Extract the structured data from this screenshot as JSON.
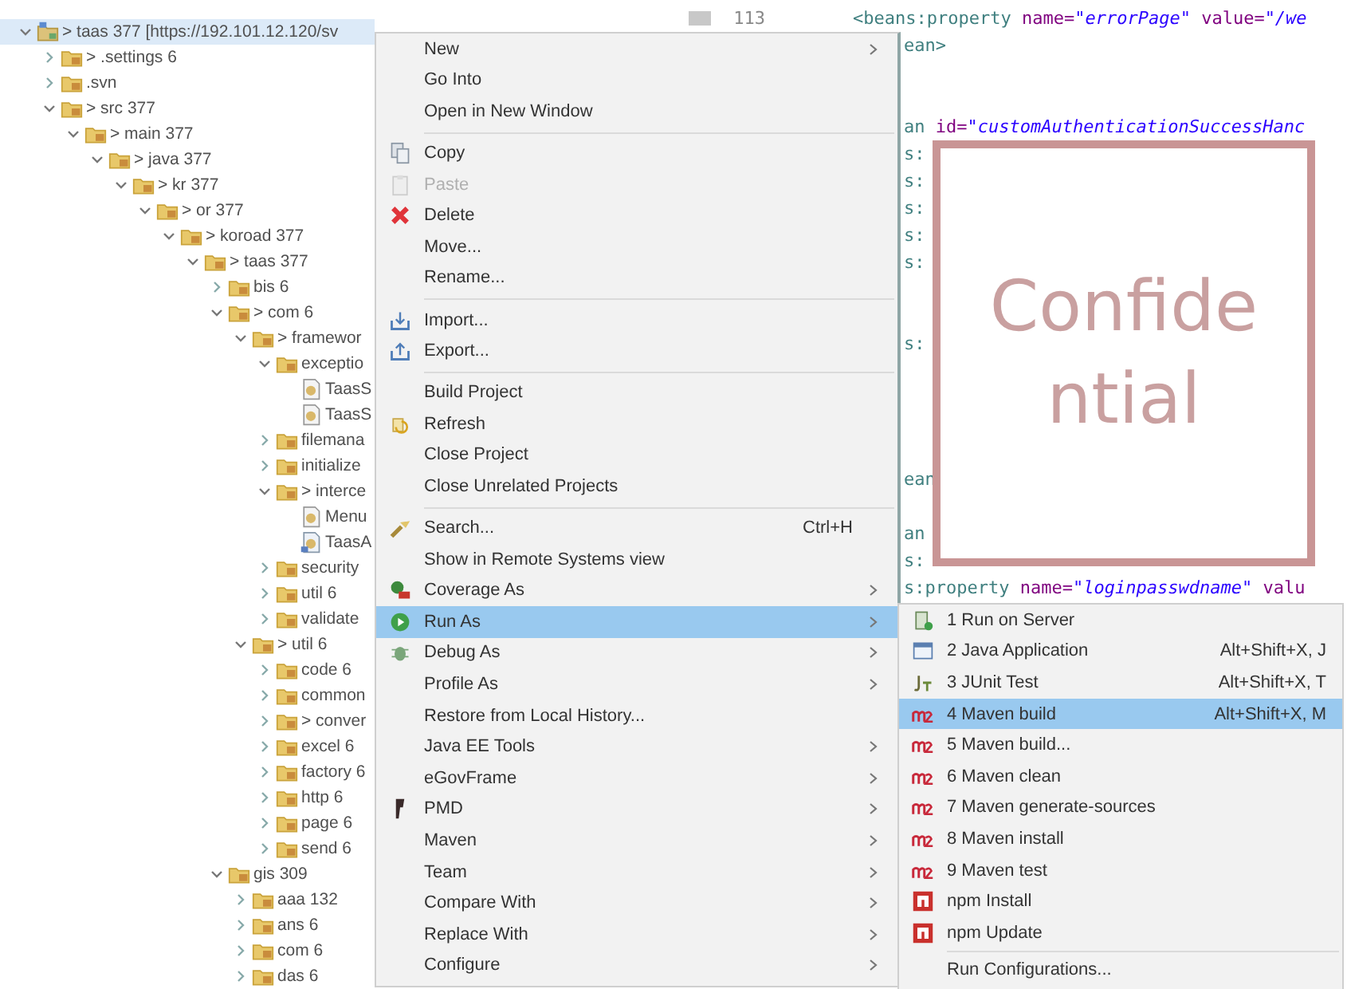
{
  "tree": [
    {
      "label": "> taas 377 [https://192.101.12.120/sv",
      "kind": "project",
      "expanded": true,
      "selected": true,
      "children": [
        {
          "label": "> .settings 6",
          "kind": "folder",
          "expanded": false,
          "selected": false
        },
        {
          "label": ".svn",
          "kind": "folder",
          "expanded": false,
          "selected": false
        },
        {
          "label": "> src 377",
          "kind": "folder",
          "expanded": true,
          "selected": false,
          "children": [
            {
              "label": "> main 377",
              "kind": "folder",
              "expanded": true,
              "selected": false,
              "children": [
                {
                  "label": "> java 377",
                  "kind": "folder",
                  "expanded": true,
                  "selected": false,
                  "children": [
                    {
                      "label": "> kr 377",
                      "kind": "folder",
                      "expanded": true,
                      "selected": false,
                      "children": [
                        {
                          "label": "> or 377",
                          "kind": "folder",
                          "expanded": true,
                          "selected": false,
                          "children": [
                            {
                              "label": "> koroad 377",
                              "kind": "folder",
                              "expanded": true,
                              "selected": false,
                              "children": [
                                {
                                  "label": "> taas 377",
                                  "kind": "folder",
                                  "expanded": true,
                                  "selected": false,
                                  "children": [
                                    {
                                      "label": "bis 6",
                                      "kind": "folder",
                                      "expanded": false,
                                      "selected": false
                                    },
                                    {
                                      "label": "> com 6",
                                      "kind": "folder",
                                      "expanded": true,
                                      "selected": false,
                                      "children": [
                                        {
                                          "label": "> framewor",
                                          "kind": "folder",
                                          "expanded": true,
                                          "selected": false,
                                          "children": [
                                            {
                                              "label": "exceptio",
                                              "kind": "folder",
                                              "expanded": true,
                                              "selected": false,
                                              "children": [
                                                {
                                                  "label": "TaasS",
                                                  "kind": "java",
                                                  "selected": false
                                                },
                                                {
                                                  "label": "TaasS",
                                                  "kind": "java",
                                                  "selected": false
                                                }
                                              ]
                                            },
                                            {
                                              "label": "filemana",
                                              "kind": "folder",
                                              "expanded": false,
                                              "selected": false
                                            },
                                            {
                                              "label": "initialize",
                                              "kind": "folder",
                                              "expanded": false,
                                              "selected": false
                                            },
                                            {
                                              "label": "> interce",
                                              "kind": "folder",
                                              "expanded": true,
                                              "selected": false,
                                              "children": [
                                                {
                                                  "label": "Menu",
                                                  "kind": "java",
                                                  "selected": false
                                                },
                                                {
                                                  "label": "TaasA",
                                                  "kind": "java-modified",
                                                  "selected": false
                                                }
                                              ]
                                            },
                                            {
                                              "label": "security",
                                              "kind": "folder",
                                              "expanded": false,
                                              "selected": false
                                            },
                                            {
                                              "label": "util 6",
                                              "kind": "folder",
                                              "expanded": false,
                                              "selected": false
                                            },
                                            {
                                              "label": "validate",
                                              "kind": "folder",
                                              "expanded": false,
                                              "selected": false
                                            }
                                          ]
                                        },
                                        {
                                          "label": "> util 6",
                                          "kind": "folder",
                                          "expanded": true,
                                          "selected": false,
                                          "children": [
                                            {
                                              "label": "code 6",
                                              "kind": "folder",
                                              "expanded": false,
                                              "selected": false
                                            },
                                            {
                                              "label": "common",
                                              "kind": "folder",
                                              "expanded": false,
                                              "selected": false
                                            },
                                            {
                                              "label": "> conver",
                                              "kind": "folder",
                                              "expanded": false,
                                              "selected": false
                                            },
                                            {
                                              "label": "excel 6",
                                              "kind": "folder",
                                              "expanded": false,
                                              "selected": false
                                            },
                                            {
                                              "label": "factory 6",
                                              "kind": "folder",
                                              "expanded": false,
                                              "selected": false
                                            },
                                            {
                                              "label": "http 6",
                                              "kind": "folder",
                                              "expanded": false,
                                              "selected": false
                                            },
                                            {
                                              "label": "page 6",
                                              "kind": "folder",
                                              "expanded": false,
                                              "selected": false
                                            },
                                            {
                                              "label": "send 6",
                                              "kind": "folder",
                                              "expanded": false,
                                              "selected": false
                                            }
                                          ]
                                        }
                                      ]
                                    },
                                    {
                                      "label": "gis 309",
                                      "kind": "folder",
                                      "expanded": true,
                                      "selected": false,
                                      "children": [
                                        {
                                          "label": "aaa 132",
                                          "kind": "folder",
                                          "expanded": false,
                                          "selected": false
                                        },
                                        {
                                          "label": "ans 6",
                                          "kind": "folder",
                                          "expanded": false,
                                          "selected": false
                                        },
                                        {
                                          "label": "com 6",
                                          "kind": "folder",
                                          "expanded": false,
                                          "selected": false
                                        },
                                        {
                                          "label": "das 6",
                                          "kind": "folder",
                                          "expanded": false,
                                          "selected": false
                                        }
                                      ]
                                    }
                                  ]
                                }
                              ]
                            }
                          ]
                        }
                      ]
                    }
                  ]
                }
              ]
            }
          ]
        }
      ]
    }
  ],
  "editor": {
    "line_number": "113",
    "lines": [
      {
        "segments": [
          {
            "text": "<beans:property ",
            "kind": "tag"
          },
          {
            "text": "name=",
            "kind": "attr"
          },
          {
            "text": "\"errorPage\"",
            "kind": "value"
          },
          {
            "text": " value=",
            "kind": "attr"
          },
          {
            "text": "\"/we",
            "kind": "value"
          }
        ]
      },
      {
        "segments": [
          {
            "text": "ean>",
            "kind": "tag"
          }
        ]
      },
      {
        "segments": [
          {
            "text": "an ",
            "kind": "tag"
          },
          {
            "text": "id=",
            "kind": "attr"
          },
          {
            "text": "\"customAuthenticationSuccessHanc",
            "kind": "value"
          }
        ]
      },
      {
        "segments": [
          {
            "text": "s:",
            "kind": "tag"
          }
        ]
      },
      {
        "segments": [
          {
            "text": "s:",
            "kind": "tag"
          }
        ]
      },
      {
        "segments": [
          {
            "text": "s:",
            "kind": "tag"
          }
        ]
      },
      {
        "segments": [
          {
            "text": "s:",
            "kind": "tag"
          }
        ]
      },
      {
        "segments": [
          {
            "text": "s:",
            "kind": "tag"
          }
        ]
      },
      {
        "segments": [
          {
            "text": "s:",
            "kind": "tag"
          }
        ]
      },
      {
        "segments": [
          {
            "text": "ean",
            "kind": "tag"
          }
        ]
      },
      {
        "segments": [
          {
            "text": "an",
            "kind": "tag"
          }
        ]
      },
      {
        "segments": [
          {
            "text": "s:",
            "kind": "tag"
          }
        ]
      },
      {
        "segments": [
          {
            "text": "s:property ",
            "kind": "tag"
          },
          {
            "text": "name=",
            "kind": "attr"
          },
          {
            "text": "\"loginpasswdname\"",
            "kind": "value"
          },
          {
            "text": " valu",
            "kind": "attr"
          }
        ]
      }
    ]
  },
  "redaction_box": {
    "lines": [
      "Confide",
      "ntial"
    ]
  },
  "context_menu": {
    "items": [
      {
        "kind": "item",
        "label": "New",
        "submenu": true,
        "disabled": false,
        "selected": false
      },
      {
        "kind": "item",
        "label": "Go Into",
        "submenu": false,
        "disabled": false,
        "selected": false
      },
      {
        "kind": "item",
        "label": "Open in New Window",
        "submenu": false,
        "disabled": false,
        "selected": false
      },
      {
        "kind": "separator"
      },
      {
        "kind": "item",
        "label": "Copy",
        "submenu": false,
        "disabled": false,
        "selected": false
      },
      {
        "kind": "item",
        "label": "Paste",
        "submenu": false,
        "disabled": true,
        "selected": false
      },
      {
        "kind": "item",
        "label": "Delete",
        "submenu": false,
        "disabled": false,
        "selected": false
      },
      {
        "kind": "item",
        "label": "Move...",
        "submenu": false,
        "disabled": false,
        "selected": false
      },
      {
        "kind": "item",
        "label": "Rename...",
        "submenu": false,
        "disabled": false,
        "selected": false
      },
      {
        "kind": "separator"
      },
      {
        "kind": "item",
        "label": "Import...",
        "submenu": false,
        "disabled": false,
        "selected": false
      },
      {
        "kind": "item",
        "label": "Export...",
        "submenu": false,
        "disabled": false,
        "selected": false
      },
      {
        "kind": "separator"
      },
      {
        "kind": "item",
        "label": "Build Project",
        "submenu": false,
        "disabled": false,
        "selected": false
      },
      {
        "kind": "item",
        "label": "Refresh",
        "submenu": false,
        "disabled": false,
        "selected": false
      },
      {
        "kind": "item",
        "label": "Close Project",
        "submenu": false,
        "disabled": false,
        "selected": false
      },
      {
        "kind": "item",
        "label": "Close Unrelated Projects",
        "submenu": false,
        "disabled": false,
        "selected": false
      },
      {
        "kind": "separator"
      },
      {
        "kind": "item",
        "label": "Search...",
        "shortcut": "Ctrl+H",
        "submenu": false,
        "disabled": false,
        "selected": false
      },
      {
        "kind": "item",
        "label": "Show in Remote Systems view",
        "submenu": false,
        "disabled": false,
        "selected": false
      },
      {
        "kind": "item",
        "label": "Coverage As",
        "submenu": true,
        "disabled": false,
        "selected": false
      },
      {
        "kind": "item",
        "label": "Run As",
        "submenu": true,
        "disabled": false,
        "selected": true
      },
      {
        "kind": "item",
        "label": "Debug As",
        "submenu": true,
        "disabled": false,
        "selected": false
      },
      {
        "kind": "item",
        "label": "Profile As",
        "submenu": true,
        "disabled": false,
        "selected": false
      },
      {
        "kind": "item",
        "label": "Restore from Local History...",
        "submenu": false,
        "disabled": false,
        "selected": false
      },
      {
        "kind": "item",
        "label": "Java EE Tools",
        "submenu": true,
        "disabled": false,
        "selected": false
      },
      {
        "kind": "item",
        "label": "eGovFrame",
        "submenu": true,
        "disabled": false,
        "selected": false
      },
      {
        "kind": "item",
        "label": "PMD",
        "submenu": true,
        "disabled": false,
        "selected": false
      },
      {
        "kind": "item",
        "label": "Maven",
        "submenu": true,
        "disabled": false,
        "selected": false
      },
      {
        "kind": "item",
        "label": "Team",
        "submenu": true,
        "disabled": false,
        "selected": false
      },
      {
        "kind": "item",
        "label": "Compare With",
        "submenu": true,
        "disabled": false,
        "selected": false
      },
      {
        "kind": "item",
        "label": "Replace With",
        "submenu": true,
        "disabled": false,
        "selected": false
      },
      {
        "kind": "item",
        "label": "Configure",
        "submenu": true,
        "disabled": false,
        "selected": false
      }
    ]
  },
  "run_as_submenu": {
    "items": [
      {
        "kind": "item",
        "label": "1 Run on Server",
        "selected": false
      },
      {
        "kind": "item",
        "label": "2 Java Application",
        "shortcut": "Alt+Shift+X, J",
        "selected": false
      },
      {
        "kind": "item",
        "label": "3 JUnit Test",
        "shortcut": "Alt+Shift+X, T",
        "selected": false
      },
      {
        "kind": "item",
        "label": "4 Maven build",
        "shortcut": "Alt+Shift+X, M",
        "selected": true
      },
      {
        "kind": "item",
        "label": "5 Maven build...",
        "selected": false
      },
      {
        "kind": "item",
        "label": "6 Maven clean",
        "selected": false
      },
      {
        "kind": "item",
        "label": "7 Maven generate-sources",
        "selected": false
      },
      {
        "kind": "item",
        "label": "8 Maven install",
        "selected": false
      },
      {
        "kind": "item",
        "label": "9 Maven test",
        "selected": false
      },
      {
        "kind": "item",
        "label": "npm Install",
        "selected": false
      },
      {
        "kind": "item",
        "label": "npm Update",
        "selected": false
      },
      {
        "kind": "separator"
      },
      {
        "kind": "item",
        "label": "Run Configurations...",
        "selected": false
      }
    ]
  }
}
